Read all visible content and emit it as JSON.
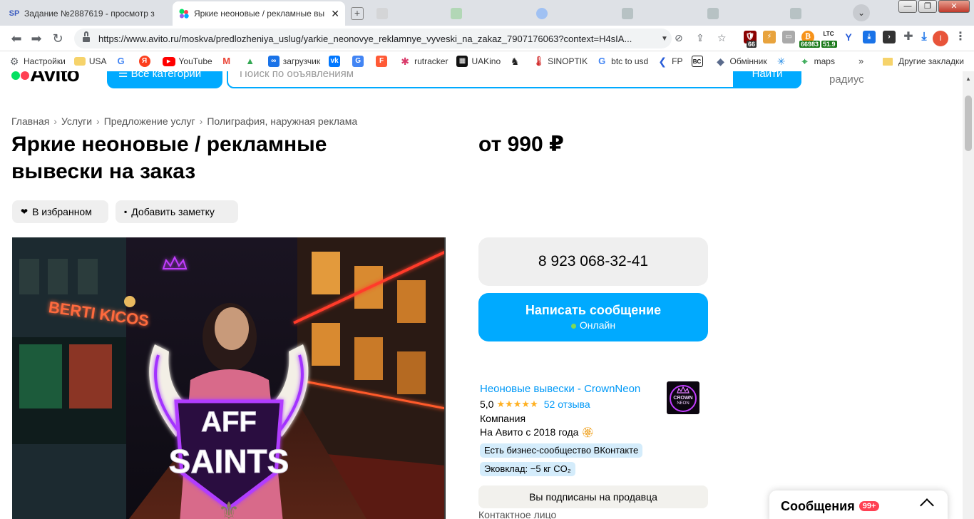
{
  "browser": {
    "tabs": [
      {
        "favicon": "SP",
        "title": "Задание №2887619 - просмотр з"
      },
      {
        "favicon": "avito-logo",
        "title": "Яркие неоновые / рекламные вы"
      }
    ],
    "new_tab_label": "+",
    "minimize_label": "—",
    "maximize_label": "❐",
    "close_label": "✕",
    "url": "https://www.avito.ru/moskva/predlozheniya_uslug/yarkie_neonovye_reklamnye_vyveski_na_zakaz_7907176063?context=H4sIA...",
    "ext_ltc": "LTC",
    "ext_ltc_value": "51.9",
    "ext_badge_66": "66",
    "ext_badge_btc": "66983",
    "profile_initial": "I",
    "bookmarks": [
      {
        "label": "Настройки",
        "icon": "gear-icon"
      },
      {
        "label": "USA",
        "icon": "folder-icon"
      },
      {
        "label": "",
        "icon": "google-icon"
      },
      {
        "label": "",
        "icon": "yandex-icon"
      },
      {
        "label": "YouTube",
        "icon": "youtube-icon"
      },
      {
        "label": "",
        "icon": "gmail-icon"
      },
      {
        "label": "",
        "icon": "drive-icon"
      },
      {
        "label": "загрузчик",
        "icon": "loop-icon"
      },
      {
        "label": "",
        "icon": "vk-icon"
      },
      {
        "label": "",
        "icon": "translate-icon"
      },
      {
        "label": "",
        "icon": "f-icon"
      },
      {
        "label": "rutracker",
        "icon": "rutracker-icon"
      },
      {
        "label": "UAKino",
        "icon": "uakino-icon"
      },
      {
        "label": "",
        "icon": "chess-icon"
      },
      {
        "label": "SINOPTIK",
        "icon": "thermometer-icon"
      },
      {
        "label": "btc to usd",
        "icon": "google-icon"
      },
      {
        "label": "FP",
        "icon": "fp-icon"
      },
      {
        "label": "",
        "icon": "bc-icon"
      },
      {
        "label": "Обмінник",
        "icon": "exchange-icon"
      },
      {
        "label": "",
        "icon": "snowflake-icon"
      },
      {
        "label": "maps",
        "icon": "maps-icon"
      }
    ],
    "bookmarks_more": "»",
    "other_bookmarks": "Другие закладки"
  },
  "header": {
    "logo": "Avito",
    "all_categories": "Все категории",
    "search_placeholder": "Поиск по объявлениям",
    "search_button": "Найти",
    "radius": "радиус"
  },
  "breadcrumb": [
    "Главная",
    "Услуги",
    "Предложение услуг",
    "Полиграфия, наружная реклама"
  ],
  "breadcrumb_sep": "›",
  "listing": {
    "title": "Яркие неоновые / рекламные вывески на заказ",
    "price": "от 990 ₽",
    "favorite_label": "В избранном",
    "note_label": "Добавить заметку",
    "photo_sign_line1": "AFF",
    "photo_sign_line2": "SAINTS",
    "photo_shop_sign": "BERTI KICOS"
  },
  "contact": {
    "phone": "8 923 068-32-41",
    "write_message": "Написать сообщение",
    "online_status": "Онлайн"
  },
  "seller": {
    "name": "Неоновые вывески - CrownNeon",
    "rating": "5,0",
    "stars": "★★★★★",
    "reviews": "52 отзыва",
    "type": "Компания",
    "since": "На Авито с 2018 года",
    "avatar_text_1": "CROWN",
    "avatar_text_2": "NEON",
    "tags": [
      "Есть бизнес-сообщество ВКонтакте",
      "Эковклад: −5 кг CO₂"
    ],
    "subscribed": "Вы подписаны на продавца",
    "contact_person": "Контактное лицо"
  },
  "messages_widget": {
    "label": "Сообщения",
    "badge": "99+"
  },
  "colors": {
    "avito_blue": "#00aaff",
    "link_blue": "#0099f7",
    "star": "#ffb021",
    "badge_red": "#ff4053",
    "chip_gray": "#efefef",
    "tag_blue": "#d4ecfb"
  }
}
